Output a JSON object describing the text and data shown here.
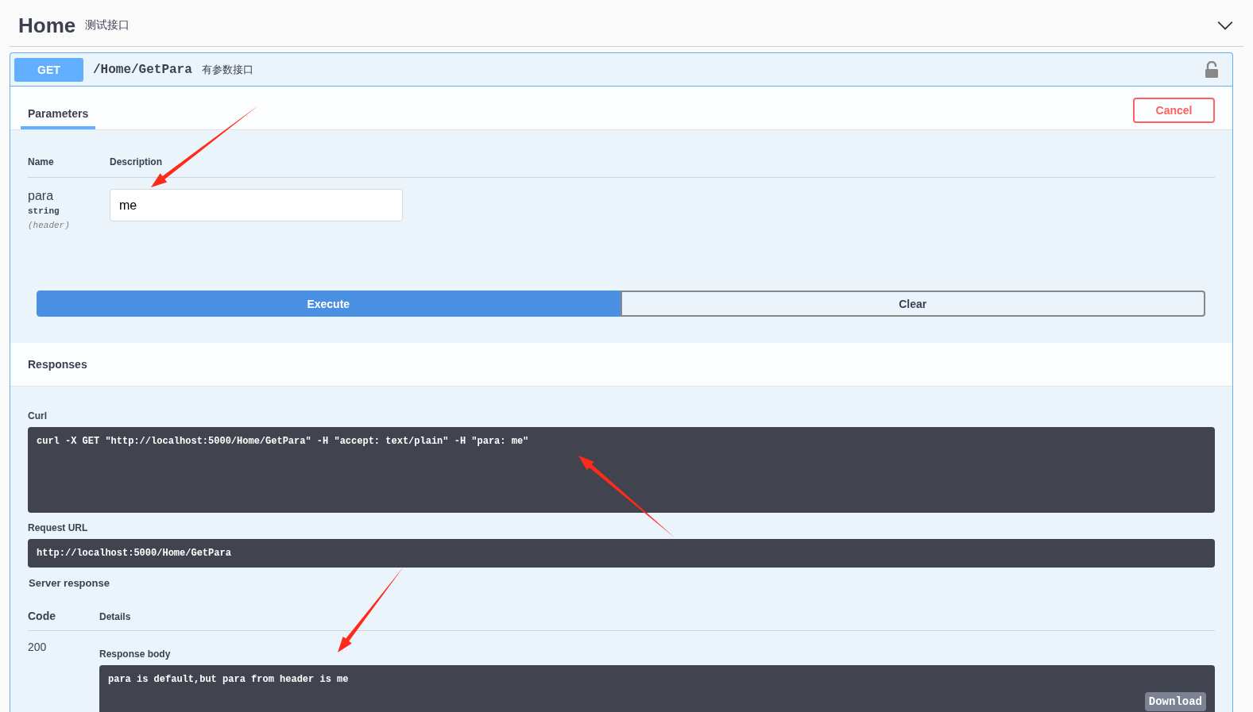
{
  "section": {
    "title": "Home",
    "description": "测试接口",
    "expanded": true
  },
  "operation": {
    "method": "GET",
    "path": "/Home/GetPara",
    "summary": "有参数接口",
    "locked": false
  },
  "tabs": [
    {
      "label": "Parameters",
      "selected": true
    }
  ],
  "cancel_button": "Cancel",
  "parameters": {
    "columns": [
      "Name",
      "Description"
    ],
    "rows": [
      {
        "name": "para",
        "type": "string",
        "location": "(header)",
        "value": "me"
      }
    ]
  },
  "buttons": [
    {
      "label": "Execute",
      "kind": "primary"
    },
    {
      "label": "Clear",
      "kind": "secondary"
    }
  ],
  "responses": {
    "title": "Responses",
    "curl_label": "Curl",
    "curl": "curl -X GET \"http://localhost:5000/Home/GetPara\" -H \"accept: text/plain\" -H \"para: me\"",
    "request_url_label": "Request URL",
    "request_url": "http://localhost:5000/Home/GetPara",
    "server_response_label": "Server response",
    "columns": [
      "Code",
      "Details"
    ],
    "rows": [
      {
        "code": "200",
        "body_label": "Response body",
        "body": "para is default,but para from header is me",
        "download": "Download"
      }
    ]
  }
}
